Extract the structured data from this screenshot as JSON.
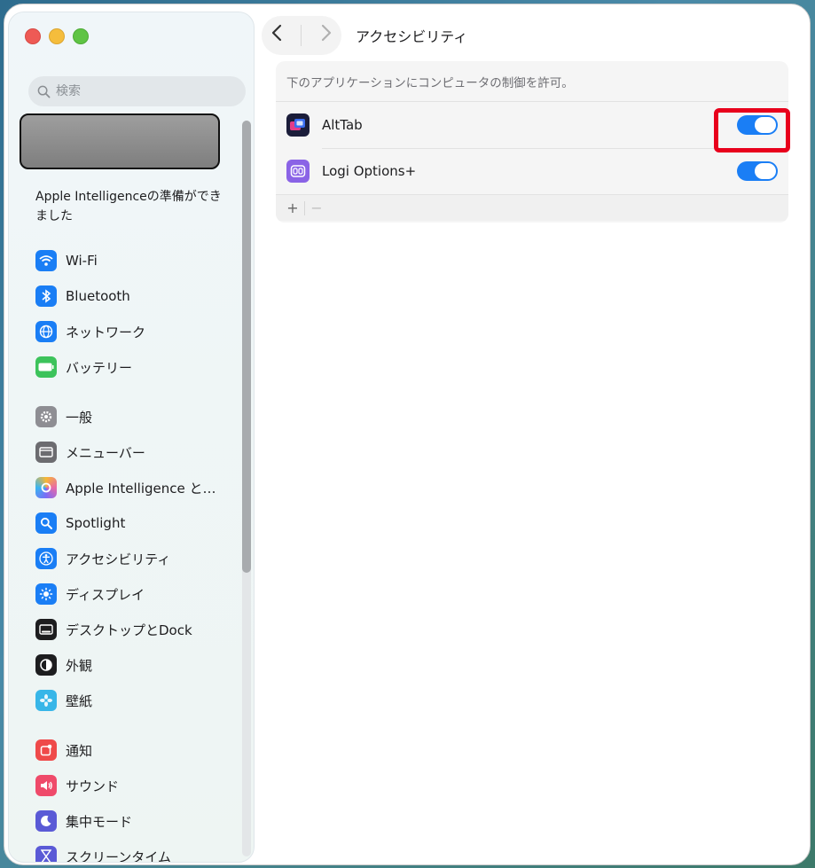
{
  "sidebar": {
    "search_placeholder": "検索",
    "ai_note": "Apple Intelligenceの準備ができました",
    "items": [
      {
        "label": "Wi-Fi",
        "color": "#1a7ef5",
        "icon": "wifi-icon"
      },
      {
        "label": "Bluetooth",
        "color": "#1a7ef5",
        "icon": "bluetooth-icon"
      },
      {
        "label": "ネットワーク",
        "color": "#1a7ef5",
        "icon": "globe-icon"
      },
      {
        "label": "バッテリー",
        "color": "#3cc35b",
        "icon": "battery-icon"
      },
      {
        "label": "一般",
        "color": "#8e8e93",
        "icon": "gear-icon"
      },
      {
        "label": "メニューバー",
        "color": "#6c6c70",
        "icon": "menubar-icon"
      },
      {
        "label": "Apple Intelligence と…",
        "color": "#e86aa8",
        "icon": "apple-intelligence-icon"
      },
      {
        "label": "Spotlight",
        "color": "#1a7ef5",
        "icon": "spotlight-icon"
      },
      {
        "label": "アクセシビリティ",
        "color": "#1a7ef5",
        "icon": "accessibility-icon"
      },
      {
        "label": "ディスプレイ",
        "color": "#1a7ef5",
        "icon": "display-icon"
      },
      {
        "label": "デスクトップとDock",
        "color": "#1d1d1f",
        "icon": "dock-icon"
      },
      {
        "label": "外観",
        "color": "#1d1d1f",
        "icon": "appearance-icon"
      },
      {
        "label": "壁紙",
        "color": "#38b6e8",
        "icon": "wallpaper-icon"
      },
      {
        "label": "通知",
        "color": "#ef4a4a",
        "icon": "notification-icon"
      },
      {
        "label": "サウンド",
        "color": "#ef4a6a",
        "icon": "sound-icon"
      },
      {
        "label": "集中モード",
        "color": "#5a5ad6",
        "icon": "focus-icon"
      },
      {
        "label": "スクリーンタイム",
        "color": "#5a5ad6",
        "icon": "screentime-icon"
      }
    ]
  },
  "toolbar": {
    "title": "アクセシビリティ"
  },
  "panel": {
    "description": "下のアプリケーションにコンピュータの制御を許可。",
    "apps": [
      {
        "name": "AltTab",
        "enabled": true,
        "icon": "alttab-app-icon"
      },
      {
        "name": "Logi Options+",
        "enabled": true,
        "icon": "logi-options-app-icon"
      }
    ],
    "add_label": "+",
    "remove_label": "−"
  }
}
